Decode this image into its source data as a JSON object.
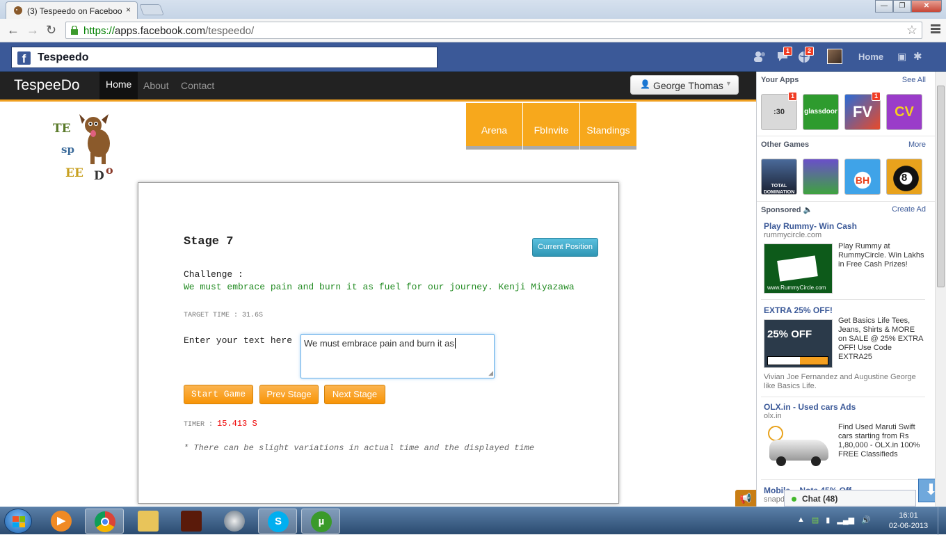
{
  "browser": {
    "tab_title": "(3) Tespeedo on Faceboo",
    "tab_close": "×",
    "url_scheme": "https://",
    "url_host": "apps.facebook.com",
    "url_path": "/tespeedo/",
    "back_glyph": "←",
    "forward_glyph": "→",
    "reload_glyph": "↻",
    "star_glyph": "☆",
    "min_glyph": "—",
    "max_glyph": "❐",
    "close_glyph": "✕"
  },
  "facebook": {
    "logo": "f",
    "search_value": "Tespeedo",
    "friend_requests_icon": "friends-icon",
    "messages_badge": "1",
    "notifications_badge": "2",
    "home_label": "Home"
  },
  "app": {
    "brand": "TespeeDo",
    "nav": [
      "Home",
      "About",
      "Contact"
    ],
    "user_button": "George Thomas",
    "logo_letters": [
      "TE",
      "sp",
      "EE",
      "D",
      "o"
    ],
    "tiles": [
      "Arena",
      "FbInvite",
      "Standings"
    ],
    "stage_title": "Stage 7",
    "current_position_button": "Current Position",
    "challenge_label": "Challenge :",
    "challenge_text": "We must embrace pain and burn it as fuel for our journey. Kenji Miyazawa",
    "target_time": "TARGET TIME : 31.6S",
    "enter_label": "Enter your text here",
    "typed_text": "We must embrace pain and burn it as",
    "buttons": {
      "start": "Start Game",
      "prev": "Prev Stage",
      "next": "Next Stage"
    },
    "timer_label": "TIMER :",
    "timer_value": "15.413 S",
    "note": "* There can be slight variations in actual time and the displayed time"
  },
  "sidebar": {
    "your_apps_title": "Your Apps",
    "see_all": "See All",
    "your_apps": [
      {
        "name": "stopwatch-app-icon",
        "label": ":30",
        "badge": "1",
        "color": "#d9d9d9"
      },
      {
        "name": "glassdoor-app-icon",
        "label": "glassdoor",
        "badge": "",
        "color": "#2e9b2e"
      },
      {
        "name": "farmville-app-icon",
        "label": "FV",
        "badge": "1",
        "color": "#2a6bd6"
      },
      {
        "name": "cityville-app-icon",
        "label": "CV",
        "badge": "",
        "color": "#9a3cc9"
      }
    ],
    "other_games_title": "Other Games",
    "more": "More",
    "other_games": [
      {
        "name": "total-domination-game-icon",
        "label": "TOTAL DOMINATION",
        "color": "#2b3550"
      },
      {
        "name": "fairy-game-icon",
        "label": "",
        "color": "#6a4fc9"
      },
      {
        "name": "bh-game-icon",
        "label": "BH",
        "color": "#3fa3e8"
      },
      {
        "name": "8-ball-pool-game-icon",
        "label": "8",
        "color": "#e8a21c"
      }
    ],
    "sponsored_title": "Sponsored",
    "create_ad": "Create Ad",
    "ads": [
      {
        "title": "Play Rummy- Win Cash",
        "domain": "rummycircle.com",
        "text": "Play Rummy at RummyCircle. Win Lakhs in Free Cash Prizes!",
        "img_caption": "www.RummyCircle.com"
      },
      {
        "title": "EXTRA 25% OFF!",
        "domain": "",
        "text": "Get Basics Life Tees, Jeans, Shirts & MORE on SALE @ 25% EXTRA OFF! Use Code EXTRA25",
        "img_caption": "25% OFF",
        "social": "Vivian Joe Fernandez and Augustine George like Basics Life."
      },
      {
        "title": "OLX.in - Used cars Ads",
        "domain": "olx.in",
        "text": "Find Used Maruti Swift cars starting from Rs 1,80,000 - OLX.in 100% FREE Classifieds",
        "img_caption": ""
      },
      {
        "title": "Mobile... Note 45% Off",
        "domain": "snapdeal.com"
      }
    ],
    "chat": "Chat (48)"
  },
  "taskbar": {
    "time": "16:01",
    "date": "02-06-2013"
  }
}
